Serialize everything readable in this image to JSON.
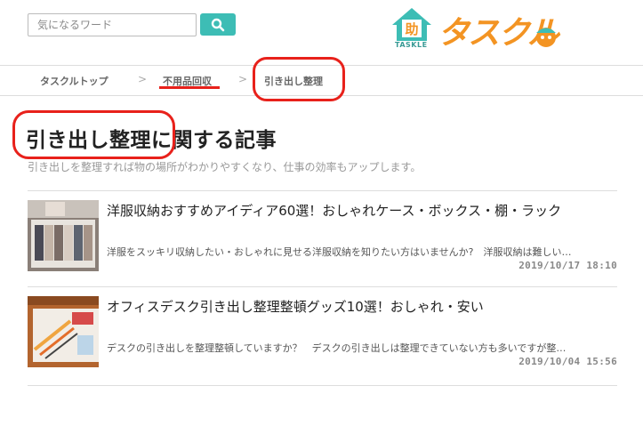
{
  "search": {
    "placeholder": "気になるワード"
  },
  "logo": {
    "text": "タスクル",
    "sub": "TASKLE",
    "badge": "助"
  },
  "breadcrumb": {
    "items": [
      "タスクルトップ",
      "不用品回収",
      "引き出し整理"
    ],
    "separator": ">"
  },
  "page": {
    "title": "引き出し整理に関する記事",
    "subtitle": "引き出しを整理すれば物の場所がわかりやすくなり、仕事の効率もアップします。"
  },
  "articles": [
    {
      "title": "洋服収納おすすめアイディア60選！おしゃれケース・ボックス・棚・ラック",
      "excerpt": "洋服をスッキリ収納したい・おしゃれに見せる洋服収納を知りたい方はいませんか?　洋服収納は難しい…",
      "date": "2019/10/17 18:10"
    },
    {
      "title": "オフィスデスク引き出し整理整頓グッズ10選！おしゃれ・安い",
      "excerpt": "デスクの引き出しを整理整頓していますか？　デスクの引き出しは整理できていない方も多いですが整…",
      "date": "2019/10/04 15:56"
    }
  ],
  "colors": {
    "accent": "#3dbdb5",
    "brand": "#f39423",
    "highlight": "#e8211b"
  }
}
